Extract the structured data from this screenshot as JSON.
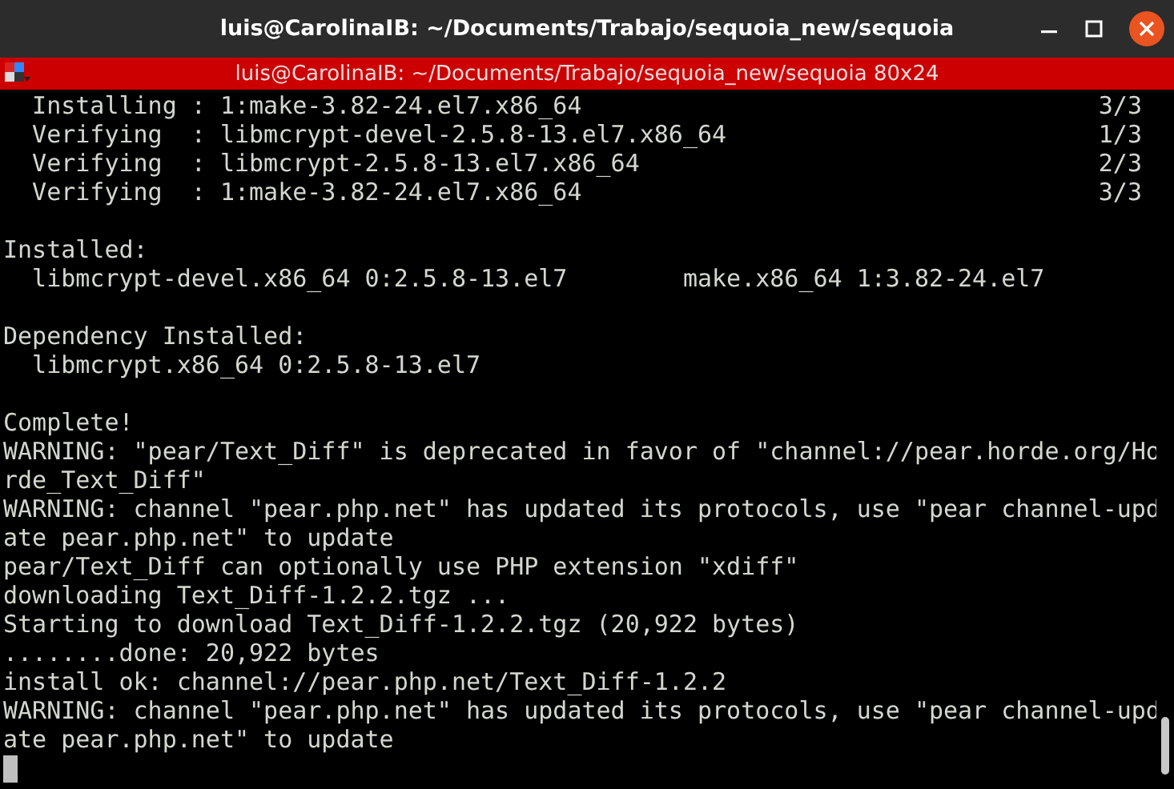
{
  "window": {
    "title": "luis@CarolinaIB: ~/Documents/Trabajo/sequoia_new/sequoia"
  },
  "terminal_header": {
    "title": "luis@CarolinaIB: ~/Documents/Trabajo/sequoia_new/sequoia 80x24"
  },
  "terminal": {
    "lines": [
      {
        "kind": "text",
        "text": "  Installing : 1:make-3.82-24.el7.x86_64",
        "progress": "3/3"
      },
      {
        "kind": "text",
        "text": "  Verifying  : libmcrypt-devel-2.5.8-13.el7.x86_64",
        "progress": "1/3"
      },
      {
        "kind": "text",
        "text": "  Verifying  : libmcrypt-2.5.8-13.el7.x86_64",
        "progress": "2/3"
      },
      {
        "kind": "text",
        "text": "  Verifying  : 1:make-3.82-24.el7.x86_64",
        "progress": "3/3"
      },
      {
        "kind": "blank"
      },
      {
        "kind": "text",
        "text": "Installed:"
      },
      {
        "kind": "text",
        "text": "  libmcrypt-devel.x86_64 0:2.5.8-13.el7        make.x86_64 1:3.82-24.el7"
      },
      {
        "kind": "blank"
      },
      {
        "kind": "text",
        "text": "Dependency Installed:"
      },
      {
        "kind": "text",
        "text": "  libmcrypt.x86_64 0:2.5.8-13.el7"
      },
      {
        "kind": "blank"
      },
      {
        "kind": "text",
        "text": "Complete!"
      },
      {
        "kind": "text",
        "text": "WARNING: \"pear/Text_Diff\" is deprecated in favor of \"channel://pear.horde.org/Ho"
      },
      {
        "kind": "text",
        "text": "rde_Text_Diff\""
      },
      {
        "kind": "text",
        "text": "WARNING: channel \"pear.php.net\" has updated its protocols, use \"pear channel-upd"
      },
      {
        "kind": "text",
        "text": "ate pear.php.net\" to update"
      },
      {
        "kind": "text",
        "text": "pear/Text_Diff can optionally use PHP extension \"xdiff\""
      },
      {
        "kind": "text",
        "text": "downloading Text_Diff-1.2.2.tgz ..."
      },
      {
        "kind": "text",
        "text": "Starting to download Text_Diff-1.2.2.tgz (20,922 bytes)"
      },
      {
        "kind": "text",
        "text": "........done: 20,922 bytes"
      },
      {
        "kind": "text",
        "text": "install ok: channel://pear.php.net/Text_Diff-1.2.2"
      },
      {
        "kind": "text",
        "text": "WARNING: channel \"pear.php.net\" has updated its protocols, use \"pear channel-upd"
      },
      {
        "kind": "text",
        "text": "ate pear.php.net\" to update"
      },
      {
        "kind": "cursor"
      }
    ]
  }
}
